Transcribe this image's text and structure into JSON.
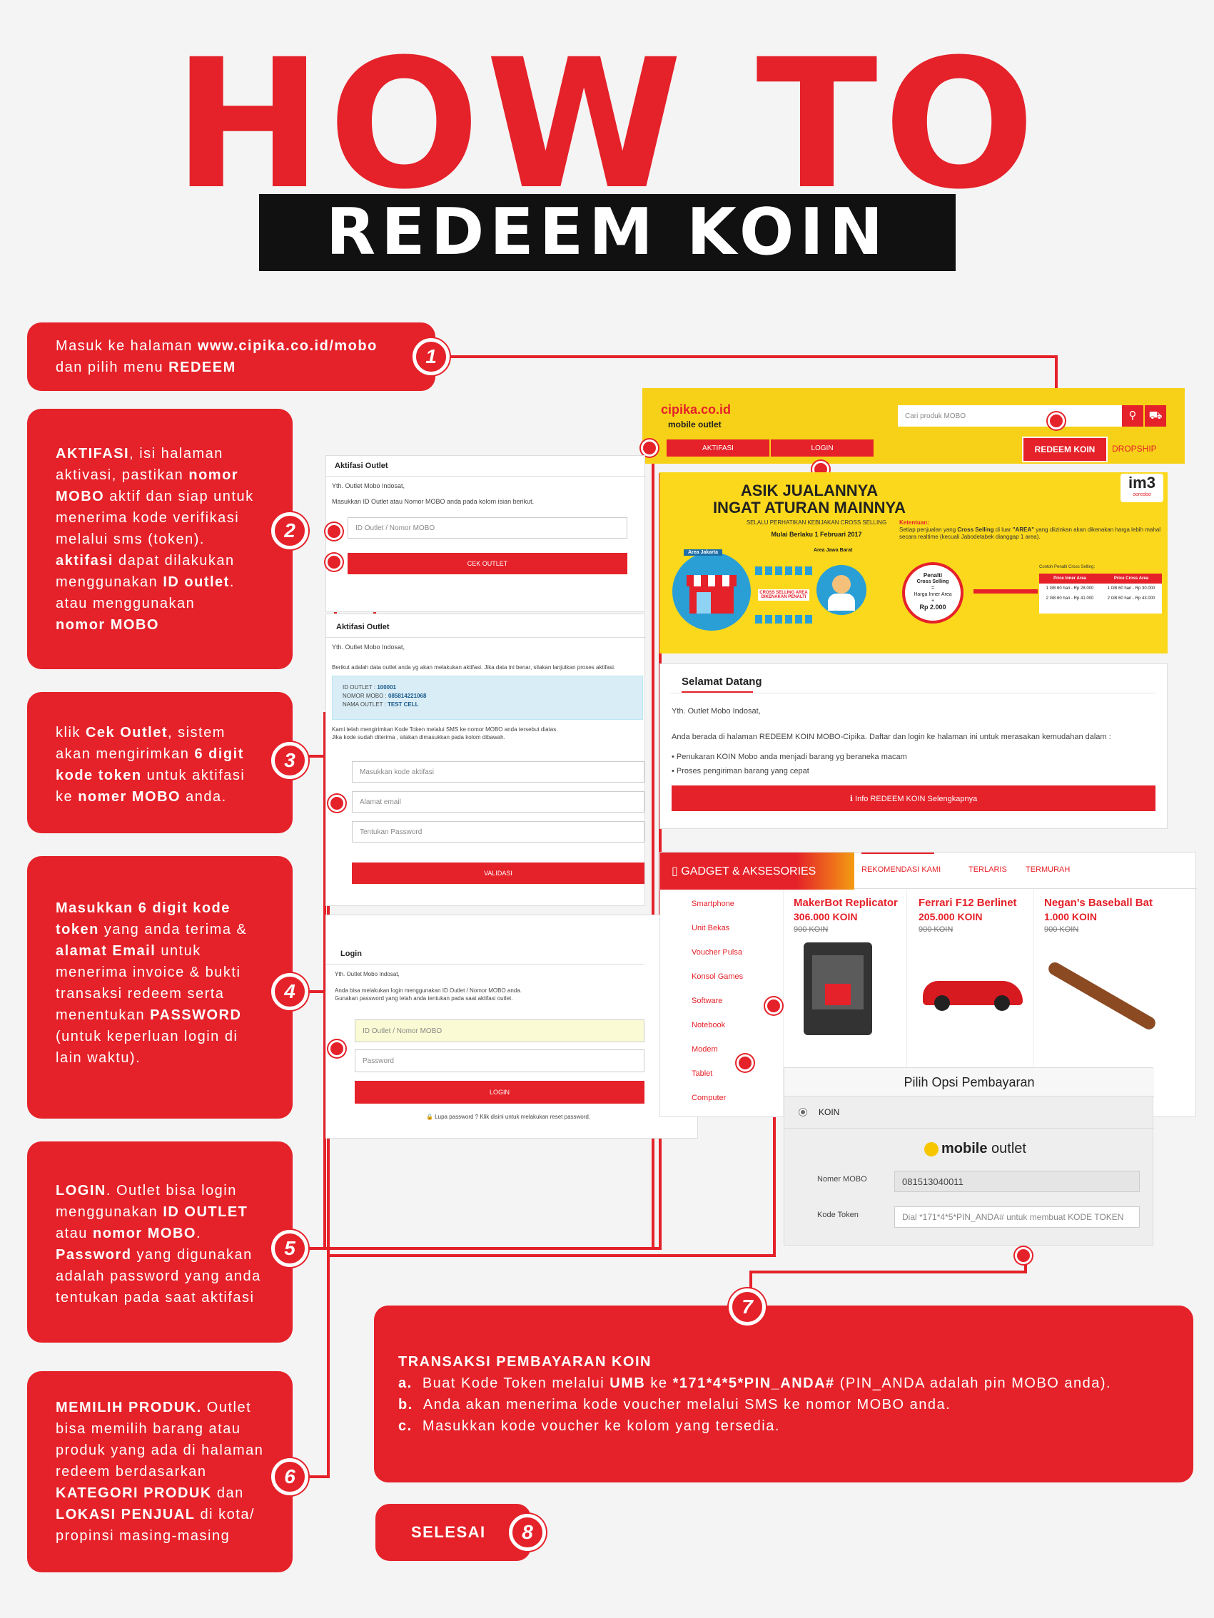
{
  "title": {
    "line1": "HOW TO",
    "line2": "REDEEM KOIN"
  },
  "steps": {
    "s1": {
      "number": "1",
      "pre": "Masuk ke halaman ",
      "url": "www.cipika.co.id/mobo",
      "mid": "dan pilih menu ",
      "menu": "REDEEM"
    },
    "s2": {
      "number": "2"
    },
    "s3": {
      "number": "3"
    },
    "s4": {
      "number": "4"
    },
    "s5": {
      "number": "5"
    },
    "s6": {
      "number": "6"
    },
    "s7": {
      "number": "7",
      "heading": "TRANSAKSI PEMBAYARAN KOIN",
      "a_letter": "a.",
      "a_pre": "Buat Kode Token melalui ",
      "a_umb": "UMB",
      "a_mid": " ke ",
      "a_code": "*171*4*5*PIN_ANDA#",
      "a_post": " (PIN_ANDA adalah pin MOBO anda).",
      "b_letter": "b.",
      "b_text": "Anda akan menerima kode voucher melalui SMS ke nomor MOBO anda.",
      "c_letter": "c.",
      "c_text": "Masukkan kode voucher ke kolom yang tersedia."
    },
    "s8": {
      "number": "8",
      "label": "SELESAI"
    }
  },
  "screens": {
    "header": {
      "logo": "cipika.co.id",
      "sub": "mobile outlet",
      "search_placeholder": "Cari produk MOBO",
      "aktifasi": "AKTIFASI",
      "login": "LOGIN",
      "redeem": "REDEEM KOIN",
      "dropship": "DROPSHIP"
    },
    "aktifasi1": {
      "title": "Aktifasi Outlet",
      "greet": "Yth. Outlet Mobo Indosat,",
      "desc": "Masukkan ID Outlet atau Nomor MOBO anda pada kolom isian berikut.",
      "input": "ID Outlet / Nomor MOBO",
      "button": "CEK OUTLET"
    },
    "aktifasi2": {
      "title": "Aktifasi Outlet",
      "greet": "Yth. Outlet Mobo Indosat,",
      "desc": "Berikut adalah data outlet anda yg akan melakukan aktifasi. Jika data ini benar, silakan lanjutkan proses aktifasi.",
      "id_label": "ID OUTLET : ",
      "id_value": "100001",
      "mobo_label": "NOMOR MOBO : ",
      "mobo_value": "085814221068",
      "name_label": "NAMA OUTLET : ",
      "name_value": "TEST CELL",
      "note1": "Kami telah mengirimkan Kode Token melalui SMS ke nomor MOBO anda tersebut diatas.",
      "note2": "Jika kode sudah diterima , silakan dimasukkan pada kolom dibawah.",
      "input_code": "Masukkan kode aktifasi",
      "input_email": "Alamat email",
      "input_pass": "Tentukan Password",
      "button": "VALIDASI"
    },
    "login": {
      "title": "Login",
      "greet": "Yth. Outlet Mobo Indosat,",
      "desc1": "Anda bisa melakukan login menggunakan ID Outlet / Nomor MOBO anda.",
      "desc2": "Gunakan password yang telah anda tentukan pada saat aktifasi outlet.",
      "input_id": "ID Outlet / Nomor MOBO",
      "input_pass": "Password",
      "button": "LOGIN",
      "forgot": "🔒 Lupa password ? Klik disini untuk melakukan reset password."
    },
    "banner": {
      "line1": "ASIK JUALANNYA",
      "line2": "INGAT ATURAN MAINNYA",
      "line3": "SELALU PERHATIKAN KEBIJAKAN CROSS SELLING",
      "line4": "Mulai Berlaku 1 Februari 2017",
      "brand": "im3",
      "brand_sub": "ooredoo",
      "ket_title": "Ketentuan:",
      "ket_pre": "Setiap penjualan yang ",
      "ket_b1": "Cross Selling",
      "ket_mid": " di luar ",
      "ket_b2": "\"AREA\"",
      "ket_post": " yang diizinkan akan dikenakan harga lebih mahal secara realtime (kecuali Jabodetabek dianggap 1 area).",
      "area1": "Area Jakarta",
      "area2": "Area Jawa Barat",
      "cross": "CROSS SELLING AREA DIKENAKAN PENALTI",
      "penalti_head": "Penalti",
      "penalti_sub": "Cross Selling",
      "penalti_eq": "=",
      "penalti_hia": "Harga Inner Area",
      "penalti_plus": "+",
      "penalti_rp": "Rp 2.000",
      "contoh": "Contoh Penalti Cross Selling:",
      "col1": "Price Inner Area",
      "col2": "Price Cross Area",
      "r1c1": "1 GB 60 hari - Rp 28.000",
      "r1c2": "1 GB 60 hari - Rp 30.000",
      "r2c1": "2 GB 60 hari - Rp 41.000",
      "r2c2": "2 GB 60 hari - Rp 43.000"
    },
    "welcome": {
      "title": "Selamat Datang",
      "greet": "Yth. Outlet Mobo Indosat,",
      "desc": "Anda berada di halaman REDEEM KOIN MOBO-Cipika. Daftar dan login ke halaman ini untuk merasakan kemudahan dalam :",
      "b1": "Penukaran KOIN Mobo anda menjadi barang yg beraneka macam",
      "b2": "Proses pengiriman barang yang cepat",
      "button": "ℹ Info REDEEM KOIN Selengkapnya"
    },
    "products": {
      "category": "▯ GADGET & AKSESORIES",
      "tabs": [
        "REKOMENDASI KAMI",
        "TERLARIS",
        "TERMURAH"
      ],
      "categories": [
        "Smartphone",
        "Unit Bekas",
        "Voucher Pulsa",
        "Konsol Games",
        "Software",
        "Notebook",
        "Modem",
        "Tablet",
        "Computer"
      ],
      "items": [
        {
          "name": "MakerBot Replicator",
          "price": "306.000 KOIN",
          "old": "900 KOIN"
        },
        {
          "name": "Ferrari F12 Berlinet",
          "price": "205.000 KOIN",
          "old": "900 KOIN"
        },
        {
          "name": "Negan's Baseball Bat",
          "price": "1.000 KOIN",
          "old": "900 KOIN"
        }
      ]
    },
    "payment": {
      "title": "Pilih Opsi Pembayaran",
      "option": "KOIN",
      "brand_strong": "mobile",
      "brand_rest": " outlet",
      "mobo_label": "Nomer MOBO",
      "mobo_value": "081513040011",
      "token_label": "Kode Token",
      "token_placeholder": "Dial *171*4*5*PIN_ANDA# untuk membuat KODE TOKEN"
    }
  }
}
